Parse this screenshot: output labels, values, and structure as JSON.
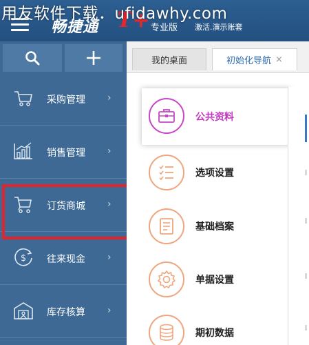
{
  "watermark": "用友软件下载．ufidawhy.com",
  "header": {
    "brand_name": "畅捷通",
    "brand_mark": "T+",
    "edition": "专业版",
    "demo_account": "激活.演示账套"
  },
  "sidebar": {
    "tools": [
      {
        "icon": "search-icon"
      },
      {
        "icon": "plus-icon"
      }
    ],
    "items": [
      {
        "label": "采购管理",
        "icon": "shopping-cart-icon"
      },
      {
        "label": "销售管理",
        "icon": "bar-chart-icon"
      },
      {
        "label": "订货商城",
        "icon": "trolley-icon",
        "highlighted": true
      },
      {
        "label": "往来现金",
        "icon": "dollar-circle-icon"
      },
      {
        "label": "库存核算",
        "icon": "warehouse-icon"
      }
    ],
    "chevron": "›"
  },
  "tabs": [
    {
      "label": "我的桌面"
    },
    {
      "label": "初始化导航",
      "close": "×"
    }
  ],
  "nav": {
    "items": [
      {
        "label": "公共资料",
        "icon": "briefcase-icon"
      },
      {
        "label": "选项设置",
        "icon": "checklist-icon"
      },
      {
        "label": "基础档案",
        "icon": "document-icon"
      },
      {
        "label": "单据设置",
        "icon": "gear-icon"
      },
      {
        "label": "期初数据",
        "icon": "database-icon"
      }
    ]
  },
  "colors": {
    "header": "#23507f",
    "sidebar": "#3d6994",
    "highlight": "#e3242b",
    "active_nav": "#c23bc0",
    "nav_icon": "#f0a57c"
  }
}
